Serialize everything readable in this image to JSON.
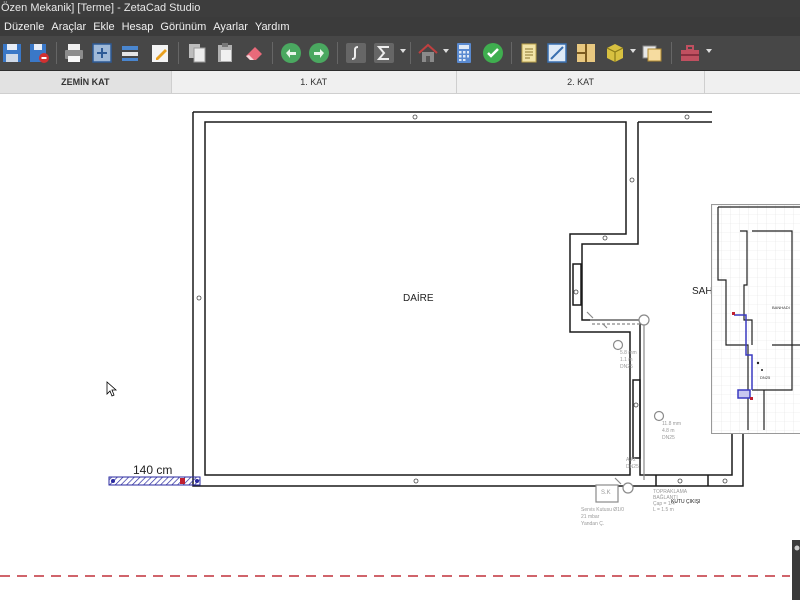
{
  "window": {
    "title": "Özen Mekanik]  [Terme]  - ZetaCad Studio"
  },
  "menu": [
    "Düzenle",
    "Araçlar",
    "Ekle",
    "Hesap",
    "Görünüm",
    "Ayarlar",
    "Yardım"
  ],
  "toolbar": {
    "icons": [
      "save-icon",
      "save-as-icon",
      "print-icon",
      "print-preview-icon",
      "layers-icon",
      "edit-icon",
      "copy-icon",
      "paste-icon",
      "eraser-icon",
      "undo-icon",
      "redo-icon",
      "symbol-icon",
      "sum-icon",
      "house-icon",
      "calculator-icon",
      "check-icon",
      "report-icon",
      "drawing-icon",
      "plan-icon",
      "3d-box-icon",
      "window-icon",
      "toolbox-icon"
    ]
  },
  "floor_tabs": [
    {
      "label": "ZEMİN KAT",
      "active": true
    },
    {
      "label": "1. KAT",
      "active": false
    },
    {
      "label": "2. KAT",
      "active": false
    }
  ],
  "drawing": {
    "room_label": "DAİRE",
    "partial_room_label": "SAH",
    "dimension_label": "140 cm",
    "annotations": {
      "a": [
        "5.8 mm",
        "1.1 m",
        "DN25"
      ],
      "b": [
        "11.8 mm",
        "4.8 m",
        "DN25"
      ],
      "c": [
        "A.Kt",
        "DN25"
      ],
      "sk_box": "S.K",
      "sk_lines": [
        "Servis Kutusu Ø1/0",
        "21 mbar",
        "Yandan Ç."
      ],
      "topraklama": [
        "TOPRAKLAMA",
        "BAĞLANTI",
        "Çap = 1/4\"",
        "L = 1.5 m"
      ],
      "kutu": "KUTU ÇIKIŞI"
    },
    "minimap": {
      "room_label": "BANHADI",
      "note": "DN25"
    }
  },
  "colors": {
    "titlebar": "#3d3d3d",
    "toolbar": "#474747",
    "wall": "#1a1a1a",
    "dimension_hatch": "#2a2aa0",
    "dashed_line": "#c0303a",
    "annotation": "#9a9a9a"
  }
}
